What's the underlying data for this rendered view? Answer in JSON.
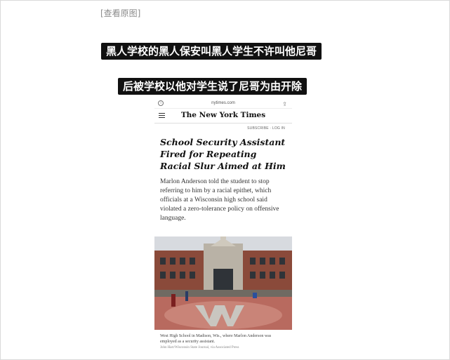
{
  "post": {
    "view_original": "[查看原图]",
    "caption_line1": "黑人学校的黑人保安叫黑人学生不许叫他尼哥",
    "caption_line2": "后被学校以他对学生说了尼哥为由开除"
  },
  "screenshot": {
    "url": "nytimes.com",
    "logo": "The New York Times",
    "account_links": "SUBSCRIBE · LOG IN",
    "headline": "School Security Assistant Fired for Repeating Racial Slur Aimed at Him",
    "summary": "Marlon Anderson told the student to stop referring to him by a racial epithet, which officials at a Wisconsin high school said violated a zero-tolerance policy on offensive language.",
    "photo_caption": "West High School in Madison, Wis., where Marlon Anderson was employed as a security assistant.",
    "photo_credit": "John Hart/Wisconsin State Journal, via Associated Press",
    "icons": [
      "info-icon",
      "share-icon",
      "menu-icon"
    ]
  }
}
